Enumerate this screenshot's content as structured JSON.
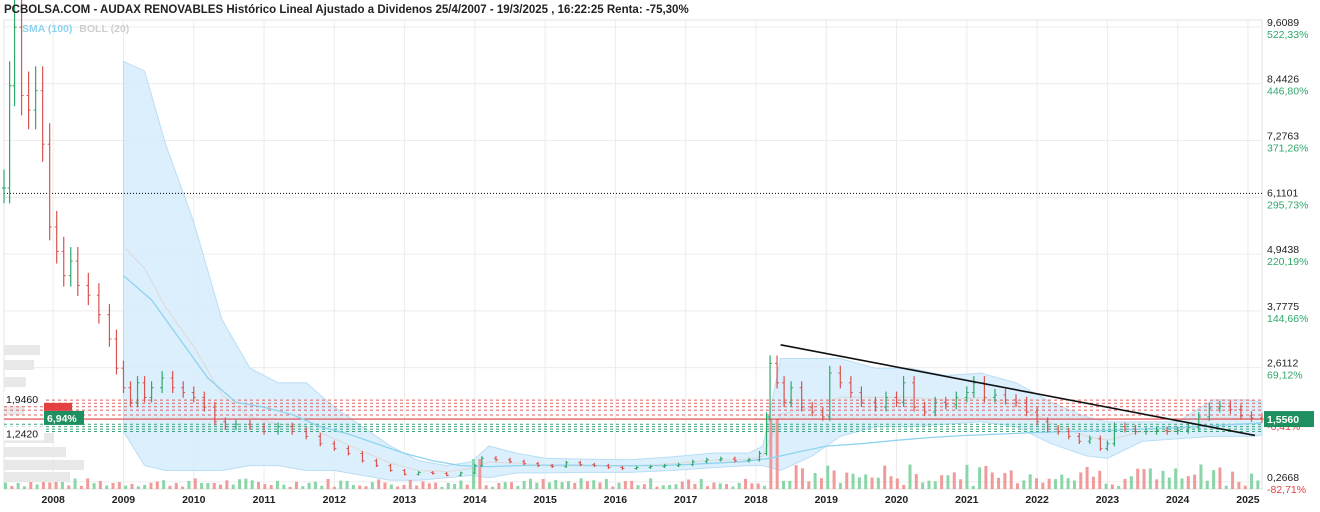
{
  "chart_data": {
    "type": "line",
    "title": "PCBOLSA.COM - AUDAX RENOVABLES Histórico Lineal Ajustado a Dividenos 25/4/2007 - 19/3/2025 , 16:22:25 Renta: -75,30%",
    "indicators": [
      "SMA (100)",
      "BOLL (20)"
    ],
    "xlabel": "",
    "ylabel": "",
    "x_ticks": [
      "2008",
      "2009",
      "2010",
      "2011",
      "2012",
      "2013",
      "2014",
      "2015",
      "2016",
      "2017",
      "2018",
      "2019",
      "2020",
      "2021",
      "2022",
      "2023",
      "2024",
      "2025"
    ],
    "y_ticks": [
      {
        "value": 9.6089,
        "label": "9,6089",
        "pct": "522,33%"
      },
      {
        "value": 8.4426,
        "label": "8,4426",
        "pct": "446,80%"
      },
      {
        "value": 7.2763,
        "label": "7,2763",
        "pct": "371,26%"
      },
      {
        "value": 6.1101,
        "label": "6,1101",
        "pct": "295,73%"
      },
      {
        "value": 4.9438,
        "label": "4,9438",
        "pct": "220,19%"
      },
      {
        "value": 3.7775,
        "label": "3,7775",
        "pct": "144,66%"
      },
      {
        "value": 2.6112,
        "label": "2,6112",
        "pct": "69,12%"
      },
      {
        "value": 1.556,
        "label": "",
        "pct": "-6,41%"
      },
      {
        "value": 0.2668,
        "label": "0,2668",
        "pct": "-82,71%"
      }
    ],
    "ylim": [
      0.12,
      9.75
    ],
    "current_price": {
      "value": 1.556,
      "label": "1,5560"
    },
    "left_labels": [
      {
        "value": 1.946,
        "label": "1,9460"
      },
      {
        "value": 1.242,
        "label": "1,2420"
      }
    ],
    "pct_badge": {
      "value": 1.58,
      "label": "6,94%"
    },
    "reference_line": {
      "value": 6.19
    },
    "trendline": {
      "start": [
        2018.35,
        3.08
      ],
      "end": [
        2025.1,
        1.22
      ]
    },
    "red_levels": [
      1.946,
      1.88,
      1.81,
      1.74,
      1.64
    ],
    "green_levels": [
      1.45,
      1.4,
      1.35,
      1.3
    ],
    "price_series": [
      [
        2007.3,
        6.3
      ],
      [
        2007.38,
        8.4
      ],
      [
        2007.45,
        9.6
      ],
      [
        2007.55,
        8.2
      ],
      [
        2007.65,
        7.9
      ],
      [
        2007.75,
        8.3
      ],
      [
        2007.85,
        7.2
      ],
      [
        2007.95,
        5.5
      ],
      [
        2008.05,
        5.0
      ],
      [
        2008.15,
        4.5
      ],
      [
        2008.25,
        4.8
      ],
      [
        2008.35,
        4.3
      ],
      [
        2008.5,
        4.1
      ],
      [
        2008.65,
        3.7
      ],
      [
        2008.8,
        3.2
      ],
      [
        2008.9,
        2.6
      ],
      [
        2009.0,
        2.2
      ],
      [
        2009.1,
        1.9
      ],
      [
        2009.2,
        2.3
      ],
      [
        2009.3,
        2.0
      ],
      [
        2009.4,
        2.2
      ],
      [
        2009.55,
        2.4
      ],
      [
        2009.7,
        2.2
      ],
      [
        2009.85,
        2.1
      ],
      [
        2010.0,
        2.0
      ],
      [
        2010.15,
        1.8
      ],
      [
        2010.3,
        1.5
      ],
      [
        2010.45,
        1.4
      ],
      [
        2010.6,
        1.45
      ],
      [
        2010.8,
        1.4
      ],
      [
        2011.0,
        1.3
      ],
      [
        2011.2,
        1.4
      ],
      [
        2011.4,
        1.3
      ],
      [
        2011.6,
        1.2
      ],
      [
        2011.8,
        1.05
      ],
      [
        2012.0,
        0.95
      ],
      [
        2012.2,
        0.85
      ],
      [
        2012.4,
        0.7
      ],
      [
        2012.6,
        0.6
      ],
      [
        2012.8,
        0.5
      ],
      [
        2013.0,
        0.42
      ],
      [
        2013.2,
        0.46
      ],
      [
        2013.4,
        0.44
      ],
      [
        2013.6,
        0.4
      ],
      [
        2013.8,
        0.45
      ],
      [
        2014.0,
        0.6
      ],
      [
        2014.1,
        0.75
      ],
      [
        2014.3,
        0.72
      ],
      [
        2014.5,
        0.68
      ],
      [
        2014.7,
        0.64
      ],
      [
        2014.9,
        0.6
      ],
      [
        2015.1,
        0.58
      ],
      [
        2015.3,
        0.66
      ],
      [
        2015.5,
        0.62
      ],
      [
        2015.7,
        0.6
      ],
      [
        2015.9,
        0.56
      ],
      [
        2016.1,
        0.54
      ],
      [
        2016.3,
        0.56
      ],
      [
        2016.5,
        0.58
      ],
      [
        2016.7,
        0.6
      ],
      [
        2016.9,
        0.62
      ],
      [
        2017.1,
        0.68
      ],
      [
        2017.3,
        0.72
      ],
      [
        2017.5,
        0.74
      ],
      [
        2017.7,
        0.7
      ],
      [
        2017.9,
        0.72
      ],
      [
        2018.05,
        0.85
      ],
      [
        2018.15,
        1.6
      ],
      [
        2018.2,
        2.7
      ],
      [
        2018.3,
        2.3
      ],
      [
        2018.4,
        1.9
      ],
      [
        2018.5,
        2.2
      ],
      [
        2018.65,
        1.8
      ],
      [
        2018.8,
        1.7
      ],
      [
        2018.95,
        1.6
      ],
      [
        2019.05,
        2.5
      ],
      [
        2019.2,
        2.3
      ],
      [
        2019.35,
        2.1
      ],
      [
        2019.5,
        1.9
      ],
      [
        2019.7,
        1.8
      ],
      [
        2019.85,
        2.0
      ],
      [
        2020.0,
        1.9
      ],
      [
        2020.1,
        2.3
      ],
      [
        2020.25,
        1.8
      ],
      [
        2020.4,
        1.7
      ],
      [
        2020.55,
        1.9
      ],
      [
        2020.7,
        1.85
      ],
      [
        2020.85,
        2.0
      ],
      [
        2021.0,
        2.1
      ],
      [
        2021.1,
        2.3
      ],
      [
        2021.25,
        2.0
      ],
      [
        2021.4,
        2.05
      ],
      [
        2021.55,
        1.95
      ],
      [
        2021.7,
        1.9
      ],
      [
        2021.85,
        1.7
      ],
      [
        2022.0,
        1.5
      ],
      [
        2022.15,
        1.35
      ],
      [
        2022.3,
        1.3
      ],
      [
        2022.45,
        1.2
      ],
      [
        2022.6,
        1.1
      ],
      [
        2022.75,
        1.15
      ],
      [
        2022.9,
        0.95
      ],
      [
        2023.0,
        1.05
      ],
      [
        2023.1,
        1.4
      ],
      [
        2023.25,
        1.35
      ],
      [
        2023.4,
        1.3
      ],
      [
        2023.55,
        1.3
      ],
      [
        2023.7,
        1.32
      ],
      [
        2023.85,
        1.3
      ],
      [
        2024.0,
        1.32
      ],
      [
        2024.15,
        1.38
      ],
      [
        2024.3,
        1.6
      ],
      [
        2024.45,
        1.78
      ],
      [
        2024.6,
        1.82
      ],
      [
        2024.75,
        1.75
      ],
      [
        2024.9,
        1.62
      ],
      [
        2025.05,
        1.58
      ],
      [
        2025.2,
        1.556
      ]
    ],
    "sma_series": [
      [
        2009.0,
        4.5
      ],
      [
        2009.4,
        4.0
      ],
      [
        2009.8,
        3.2
      ],
      [
        2010.2,
        2.4
      ],
      [
        2010.6,
        1.9
      ],
      [
        2011.0,
        1.8
      ],
      [
        2011.4,
        1.65
      ],
      [
        2011.8,
        1.4
      ],
      [
        2012.2,
        1.25
      ],
      [
        2012.6,
        1.05
      ],
      [
        2013.0,
        0.85
      ],
      [
        2013.4,
        0.7
      ],
      [
        2013.8,
        0.6
      ],
      [
        2014.2,
        0.58
      ],
      [
        2014.6,
        0.6
      ],
      [
        2015.0,
        0.61
      ],
      [
        2015.4,
        0.61
      ],
      [
        2015.8,
        0.6
      ],
      [
        2016.2,
        0.6
      ],
      [
        2016.6,
        0.6
      ],
      [
        2017.0,
        0.62
      ],
      [
        2017.4,
        0.65
      ],
      [
        2017.8,
        0.68
      ],
      [
        2018.2,
        0.75
      ],
      [
        2018.6,
        0.88
      ],
      [
        2019.0,
        1.0
      ],
      [
        2019.5,
        1.05
      ],
      [
        2020.0,
        1.12
      ],
      [
        2020.5,
        1.18
      ],
      [
        2021.0,
        1.22
      ],
      [
        2021.5,
        1.25
      ],
      [
        2022.0,
        1.28
      ],
      [
        2022.5,
        1.3
      ],
      [
        2023.0,
        1.32
      ],
      [
        2023.5,
        1.35
      ],
      [
        2024.0,
        1.38
      ],
      [
        2024.5,
        1.42
      ],
      [
        2025.0,
        1.46
      ],
      [
        2025.2,
        1.48
      ]
    ],
    "boll_band": [
      [
        2009.0,
        8.9,
        1.3
      ],
      [
        2009.3,
        8.7,
        0.6
      ],
      [
        2009.6,
        7.2,
        0.5
      ],
      [
        2010.0,
        5.6,
        0.5
      ],
      [
        2010.4,
        3.6,
        0.5
      ],
      [
        2010.8,
        2.6,
        0.6
      ],
      [
        2011.2,
        2.3,
        0.6
      ],
      [
        2011.6,
        2.3,
        0.5
      ],
      [
        2012.0,
        1.8,
        0.5
      ],
      [
        2012.4,
        1.4,
        0.4
      ],
      [
        2012.8,
        1.0,
        0.3
      ],
      [
        2013.2,
        0.7,
        0.3
      ],
      [
        2013.6,
        0.6,
        0.35
      ],
      [
        2013.95,
        0.68,
        0.4
      ],
      [
        2014.2,
        1.0,
        0.35
      ],
      [
        2014.6,
        0.85,
        0.45
      ],
      [
        2015.0,
        0.75,
        0.45
      ],
      [
        2015.6,
        0.73,
        0.46
      ],
      [
        2016.2,
        0.72,
        0.46
      ],
      [
        2016.8,
        0.78,
        0.5
      ],
      [
        2017.4,
        0.86,
        0.56
      ],
      [
        2017.9,
        0.86,
        0.6
      ],
      [
        2018.1,
        1.0,
        0.6
      ],
      [
        2018.35,
        2.8,
        0.5
      ],
      [
        2018.8,
        2.8,
        0.8
      ],
      [
        2019.2,
        2.8,
        1.2
      ],
      [
        2019.7,
        2.6,
        1.4
      ],
      [
        2020.2,
        2.6,
        1.4
      ],
      [
        2020.7,
        2.45,
        1.45
      ],
      [
        2021.2,
        2.5,
        1.5
      ],
      [
        2021.7,
        2.3,
        1.4
      ],
      [
        2022.2,
        1.9,
        1.05
      ],
      [
        2022.7,
        1.6,
        0.8
      ],
      [
        2023.0,
        1.5,
        0.75
      ],
      [
        2023.5,
        1.5,
        1.1
      ],
      [
        2024.0,
        1.5,
        1.15
      ],
      [
        2024.5,
        1.95,
        1.2
      ],
      [
        2025.0,
        1.95,
        1.2
      ],
      [
        2025.2,
        1.9,
        1.22
      ]
    ]
  }
}
